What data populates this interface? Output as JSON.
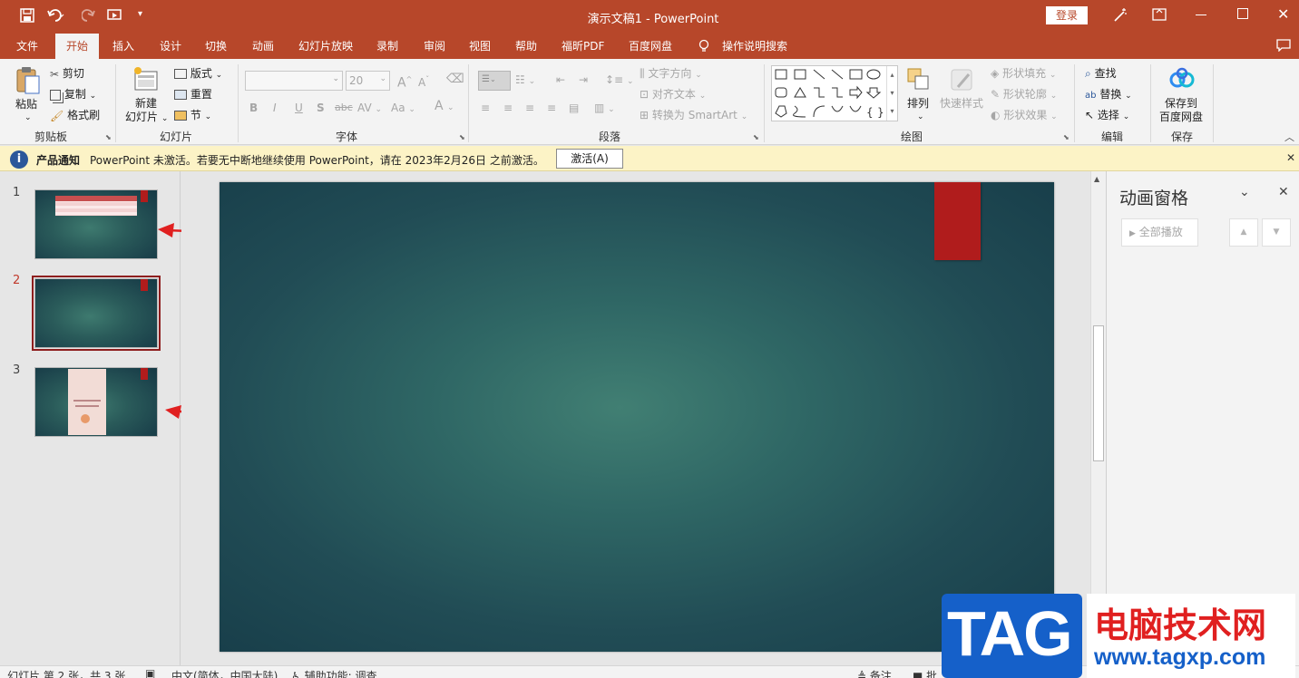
{
  "window": {
    "title": "演示文稿1 - PowerPoint",
    "login": "登录"
  },
  "tabs": [
    "文件",
    "开始",
    "插入",
    "设计",
    "切换",
    "动画",
    "幻灯片放映",
    "录制",
    "审阅",
    "视图",
    "帮助",
    "福昕PDF",
    "百度网盘"
  ],
  "active_tab": "开始",
  "tell_me": "操作说明搜索",
  "ribbon": {
    "clipboard": {
      "paste": "粘贴",
      "cut": "剪切",
      "copy": "复制",
      "format_painter": "格式刷",
      "label": "剪贴板"
    },
    "slides": {
      "new_slide_1": "新建",
      "new_slide_2": "幻灯片",
      "layout": "版式",
      "reset": "重置",
      "section": "节",
      "label": "幻灯片"
    },
    "font": {
      "font_size": "20",
      "bold": "B",
      "italic": "I",
      "underline": "U",
      "shadow": "S",
      "strike": "abc",
      "spacing": "AV",
      "case": "Aa",
      "color": "A",
      "label": "字体"
    },
    "paragraph": {
      "text_direction": "文字方向",
      "align_text": "对齐文本",
      "smartart": "转换为 SmartArt",
      "label": "段落"
    },
    "drawing": {
      "arrange": "排列",
      "quick_styles": "快速样式",
      "shape_fill": "形状填充",
      "shape_outline": "形状轮廓",
      "shape_effects": "形状效果",
      "label": "绘图"
    },
    "editing": {
      "find": "查找",
      "replace": "替换",
      "select": "选择",
      "label": "编辑"
    },
    "save": {
      "line1": "保存到",
      "line2": "百度网盘",
      "label": "保存"
    }
  },
  "notification": {
    "title": "产品通知",
    "message": "PowerPoint 未激活。若要无中断地继续使用 PowerPoint，请在 2023年2月26日 之前激活。",
    "button": "激活(A)"
  },
  "thumbnails": [
    {
      "num": "1"
    },
    {
      "num": "2"
    },
    {
      "num": "3"
    }
  ],
  "animation_pane": {
    "title": "动画窗格",
    "play_all": "全部播放"
  },
  "status": {
    "slide_info": "幻灯片 第 2 张，共 3 张",
    "language": "中文(简体，中国大陆)",
    "accessibility": "辅助功能: 调查",
    "notes": "备注",
    "comments": "批"
  },
  "watermark": {
    "tag": "TAG",
    "site_name": "电脑技术网",
    "url": "www.tagxp.com"
  },
  "colors": {
    "accent": "#b7472a",
    "slide_bg": "#2a5a5a",
    "slide_red_tab": "#b01c1c",
    "notify_bg": "#fcf3c6",
    "arrow": "#e02020"
  }
}
